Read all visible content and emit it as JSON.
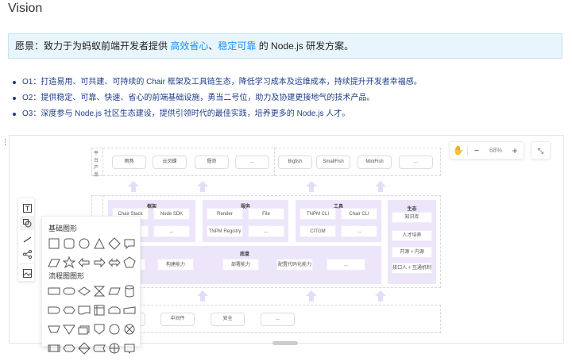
{
  "title": "Vision",
  "vision": {
    "prefix": "愿景：致力于为蚂蚁前端开发者提供 ",
    "hl1": "高效省心",
    "sep": "、",
    "hl2": "稳定可靠",
    "suffix": " 的 Node.js 研发方案。"
  },
  "objectives": [
    "O1：打造易用、可共建、可持续的 Chair 框架及工具链生态，降低学习成本及运维成本，持续提升开发者幸福感。",
    "O2：提供稳定、可靠、快速、省心的前端基础设施，勇当二号位，助力及协建更接地气的技术产品。",
    "O3：深度参与 Node.js 社区生态建设，提供引领时代的最佳实践，培养更多的 Node.js 人才。"
  ],
  "colors": {
    "accent": "#1890ff",
    "group_bg": "#ede6fa",
    "objective_text": "#1f3d8a"
  },
  "diagram": {
    "platform_label": "平台产品",
    "platform": [
      "雨燕",
      "云凤蝶",
      "偃奇",
      "...",
      "Bigfish",
      "SmallFish",
      "MiniFish",
      "..."
    ],
    "framework": {
      "title": "框架",
      "items": [
        "Chair Stack",
        "Node SDK",
        "...",
        "..."
      ]
    },
    "service": {
      "title": "服务",
      "items": [
        "Render",
        "File",
        "TNPM Registry",
        "..."
      ]
    },
    "tools": {
      "title": "工具",
      "items": [
        "TNPM CLI",
        "Chair CLI",
        "CITGM",
        "..."
      ]
    },
    "ecology": {
      "title": "生态",
      "items": [
        "知识库",
        "人才培养",
        "开源 + 内源",
        "接口人 + 互通机制"
      ]
    },
    "chassis": {
      "title": "底盘",
      "items": [
        "构建能力",
        "部署能力",
        "配置代码化能力",
        "..."
      ]
    },
    "base": [
      "中间件",
      "安全",
      "..."
    ]
  },
  "zoom": {
    "level": "68%",
    "minus": "−",
    "plus": "+"
  },
  "palette": {
    "basic_title": "基础图形",
    "flow_title": "流程图图形"
  },
  "icons": {
    "hand": "hand-icon",
    "fullscreen": "fullscreen-icon",
    "text": "text-icon",
    "shape": "shape-icon",
    "line": "line-icon",
    "mindmap": "mindmap-icon",
    "image": "image-icon"
  }
}
